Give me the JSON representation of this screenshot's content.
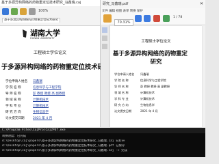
{
  "left_window": {
    "title": "基于多源异构网络的药物重定位技术研究_冯鑫瑞.caj",
    "zoom": "100%",
    "tab_label": "基于多源异构网络的药物重定位技术研究",
    "logo_text": "湖南大学",
    "logo_subtext": "HUNAN UNIVERSITY",
    "degree": "工程硕士学位论文",
    "thesis_title": "于多源异构网络的药物重定位技术研究",
    "fields": [
      {
        "label": "学位申请人姓名",
        "value": "冯鑫瑞"
      },
      {
        "label": "学 院 名 称",
        "value": "信息科学与工程学院"
      },
      {
        "label": "导 师 名 称",
        "value": "彭 教授  教授  高 副教授"
      },
      {
        "label": "领 域 名 称",
        "value": "计算机技术"
      },
      {
        "label": "学 科 专 业",
        "value": "计算机技术"
      },
      {
        "label": "研 究 方 向",
        "value": "生物信息学"
      },
      {
        "label": "论文提交日期",
        "value": "2021 年 4 月"
      }
    ]
  },
  "right_window": {
    "title": "研究_冯鑫瑞.pdf",
    "zoom": "70.31%",
    "page_counter": "1 / 78",
    "menu": [
      "文件",
      "编辑",
      "视图",
      "表单",
      "转换",
      "保护"
    ],
    "degree": "工程硕士学位论文",
    "thesis_title_line1": "基于多源异构网络的药物重定",
    "thesis_title_line2": "研究",
    "fields": [
      {
        "label": "学位申请人姓名",
        "value": "冯鑫瑞"
      },
      {
        "label": "学 院 名 称",
        "value": "信息科学与工程学院"
      },
      {
        "label": "导 师 名 称",
        "value": "彭 教授  教授  高 副教授"
      },
      {
        "label": "领 域 名 称",
        "value": "计算机技术"
      },
      {
        "label": "学 科 专 业",
        "value": "计算机技术"
      },
      {
        "label": "研 究 方 向",
        "value": "生物信息学"
      },
      {
        "label": "论文提交日期",
        "value": "2021 年 4 月"
      }
    ]
  },
  "console": {
    "title": "C:\\Program Files\\CajPro\\Caj2Pdf.exe",
    "lines": [
      "转换进度：已完成",
      "d:\\Desktop\\caj\\papers\\基于多源异构网络的药物重定位技术研究_冯鑫瑞.caj 已打开",
      "d:\\Desktop\\caj\\papers\\基于多源异构网络的药物重定位技术研究_冯鑫瑞.pdf 已保存",
      "d:\\Desktop\\caj\\papers\\基于多源异构网络的药物重定位技术研究_冯鑫瑞.caj -> 完成"
    ]
  },
  "colors": {
    "accent_blue": "#2b6cd6",
    "console_bg": "#0b0b0b",
    "page_bg": "#ffffff",
    "link_blue": "#1f3f9f"
  }
}
